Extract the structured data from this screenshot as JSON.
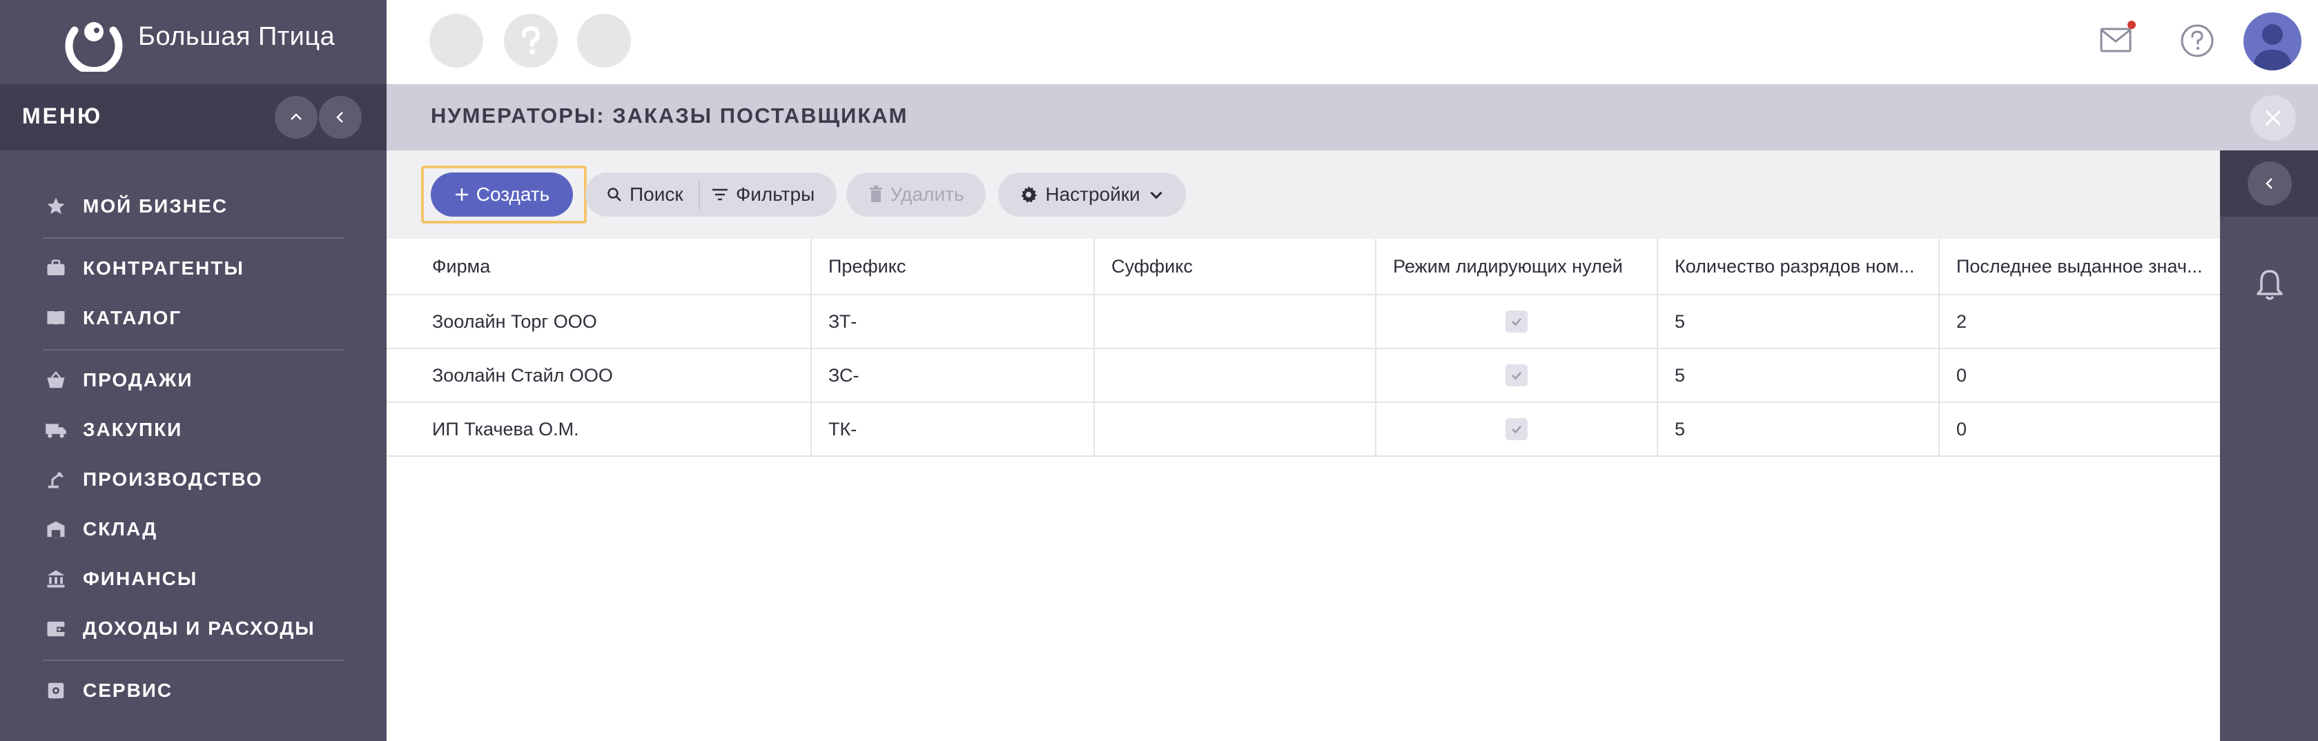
{
  "app": {
    "logo_text": "Большая Птица"
  },
  "menu": {
    "title": "МЕНЮ",
    "items": [
      {
        "label": "МОЙ БИЗНЕС",
        "icon": "star-icon"
      },
      {
        "label": "КОНТРАГЕНТЫ",
        "icon": "briefcase-icon"
      },
      {
        "label": "КАТАЛОГ",
        "icon": "book-icon"
      },
      {
        "label": "ПРОДАЖИ",
        "icon": "basket-icon"
      },
      {
        "label": "ЗАКУПКИ",
        "icon": "truck-icon"
      },
      {
        "label": "ПРОИЗВОДСТВО",
        "icon": "robot-arm-icon"
      },
      {
        "label": "СКЛАД",
        "icon": "warehouse-icon"
      },
      {
        "label": "ФИНАНСЫ",
        "icon": "bank-icon"
      },
      {
        "label": "ДОХОДЫ И РАСХОДЫ",
        "icon": "wallet-icon"
      },
      {
        "label": "СЕРВИС",
        "icon": "service-icon"
      }
    ]
  },
  "page": {
    "title": "НУМЕРАТОРЫ: ЗАКАЗЫ ПОСТАВЩИКАМ"
  },
  "toolbar": {
    "create": "Создать",
    "search": "Поиск",
    "filters": "Фильтры",
    "delete": "Удалить",
    "settings": "Настройки"
  },
  "table": {
    "headers": [
      "Фирма",
      "Префикс",
      "Суффикс",
      "Режим лидирующих нулей",
      "Количество разрядов ном...",
      "Последнее выданное знач..."
    ],
    "rows": [
      {
        "firm": "Зоолайн Торг ООО",
        "prefix": "ЗТ-",
        "suffix": "",
        "leading_zeros": true,
        "digits": "5",
        "last_value": "2"
      },
      {
        "firm": "Зоолайн Стайл ООО",
        "prefix": "ЗС-",
        "suffix": "",
        "leading_zeros": true,
        "digits": "5",
        "last_value": "0"
      },
      {
        "firm": "ИП Ткачева О.М.",
        "prefix": "ТК-",
        "suffix": "",
        "leading_zeros": true,
        "digits": "5",
        "last_value": "0"
      }
    ]
  },
  "colors": {
    "sidebar": "#4f4e63",
    "sidebar_dark": "#3f3e51",
    "accent": "#5a64c0",
    "focus": "#f5c46b",
    "notification": "#d33a2f"
  }
}
